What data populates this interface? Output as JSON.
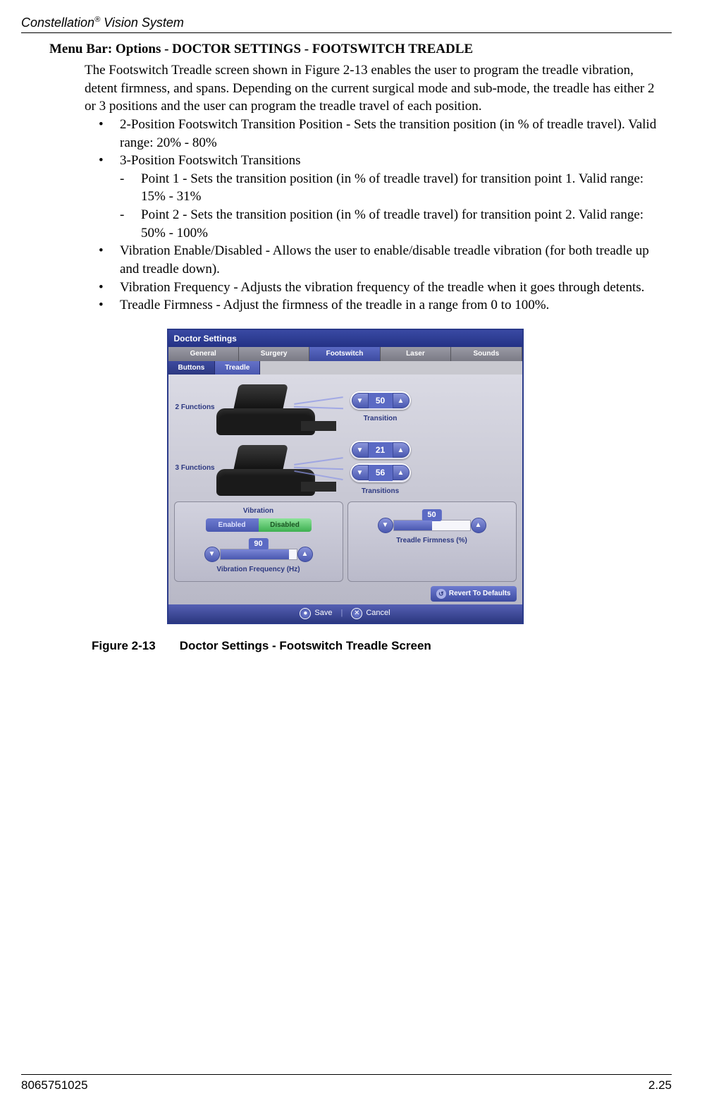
{
  "header": {
    "brand": "Constellation",
    "brand_suffix": " Vision System"
  },
  "heading": "Menu Bar: Options - DOCTOR SETTINGS - FOOTSWITCH TREADLE",
  "intro": "The Footswitch Treadle screen shown in Figure 2-13 enables the user to program the treadle vibration, detent firmness, and spans. Depending on the current surgical mode and sub-mode, the treadle has either 2 or 3 positions and the user can program the treadle travel of each position.",
  "bullets": {
    "b1": "2-Position Footswitch Transition Position - Sets the transition position (in % of treadle travel). Valid range: 20% - 80%",
    "b2": "3-Position Footswitch Transitions",
    "b2a": "Point 1 - Sets the transition position (in % of treadle travel) for transition point 1. Valid range: 15% - 31%",
    "b2b": "Point 2 - Sets the transition position (in % of treadle travel) for transition point 2. Valid range: 50% - 100%",
    "b3": "Vibration Enable/Disabled - Allows the user to enable/disable treadle vibration (for both treadle up and treadle down).",
    "b4": "Vibration Frequency - Adjusts the vibration frequency of the treadle when it goes through detents.",
    "b5": "Treadle Firmness - Adjust the firmness of the treadle in a range from 0 to 100%."
  },
  "figure": {
    "num": "Figure 2-13",
    "caption": "Doctor Settings - Footswitch Treadle Screen"
  },
  "footer": {
    "left": "8065751025",
    "right": "2.25"
  },
  "shot": {
    "title": "Doctor Settings",
    "tabs": {
      "general": "General",
      "surgery": "Surgery",
      "footswitch": "Footswitch",
      "laser": "Laser",
      "sounds": "Sounds"
    },
    "subtabs": {
      "buttons": "Buttons",
      "treadle": "Treadle"
    },
    "func2": {
      "label": "2 Functions",
      "transition_label": "Transition",
      "value": "50"
    },
    "func3": {
      "label": "3 Functions",
      "transitions_label": "Transitions",
      "value1": "21",
      "value2": "56"
    },
    "vibration": {
      "title": "Vibration",
      "enabled": "Enabled",
      "disabled": "Disabled",
      "freq_label": "Vibration Frequency (Hz)",
      "freq_value": "90"
    },
    "firmness": {
      "label": "Treadle Firmness (%)",
      "value": "50"
    },
    "revert": "Revert To Defaults",
    "save": "Save",
    "cancel": "Cancel"
  }
}
